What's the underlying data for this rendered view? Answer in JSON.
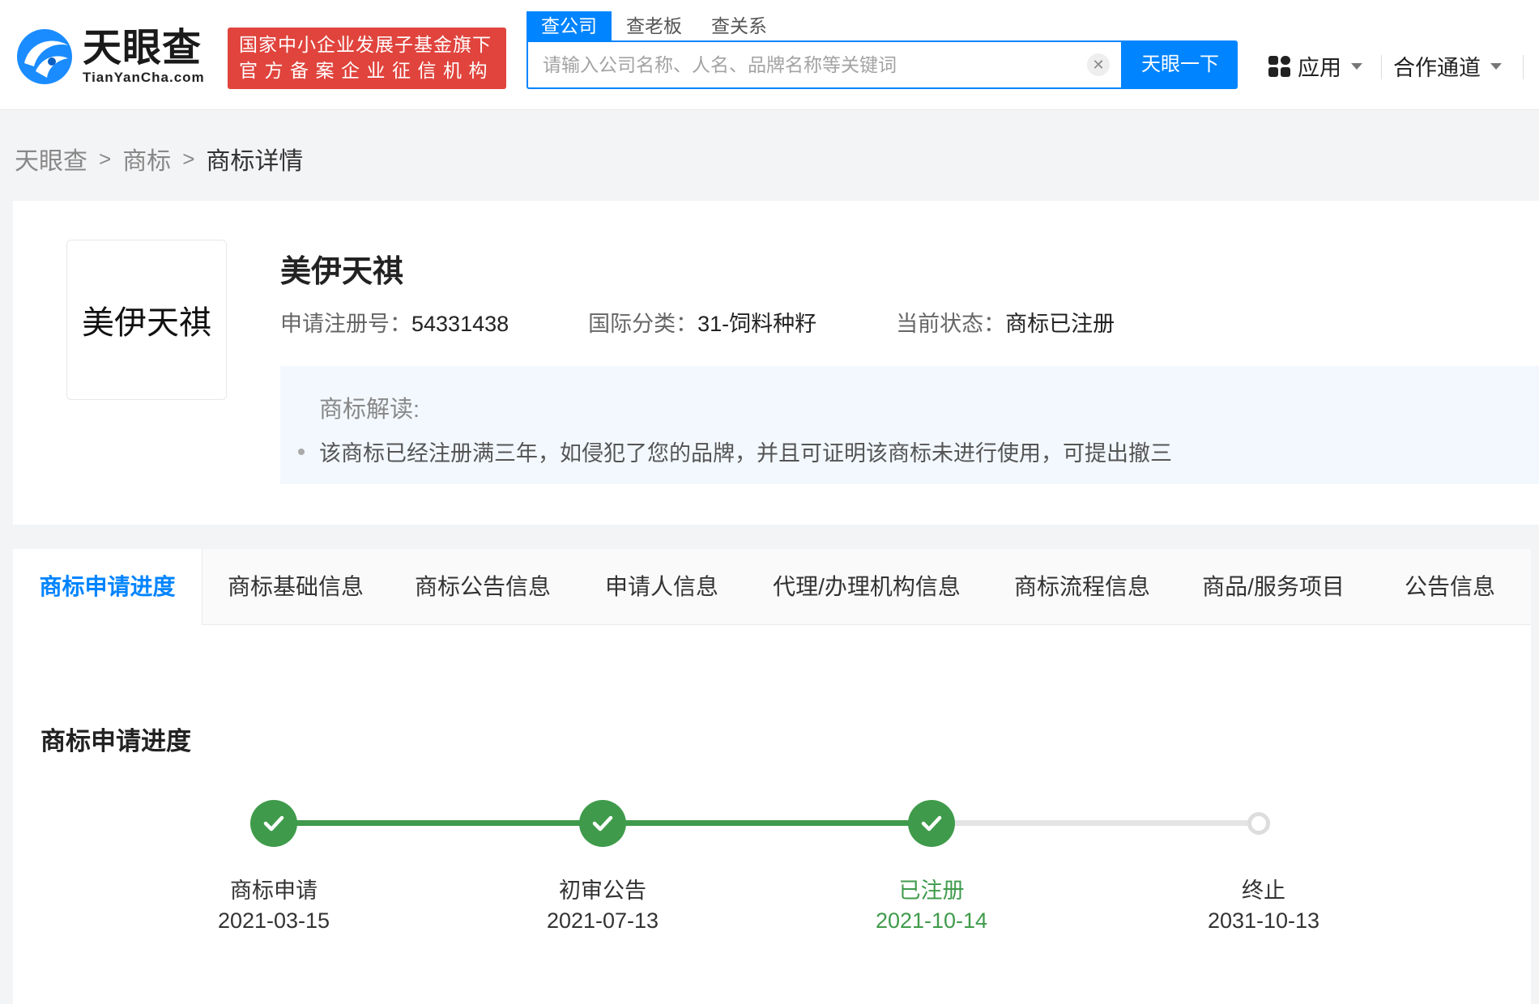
{
  "header": {
    "logo_cn": "天眼查",
    "logo_en": "TianYanCha.com",
    "badge_line1": "国家中小企业发展子基金旗下",
    "badge_line2": "官方备案企业征信机构",
    "search_tabs": [
      "查公司",
      "查老板",
      "查关系"
    ],
    "search_placeholder": "请输入公司名称、人名、品牌名称等关键词",
    "search_button": "天眼一下",
    "nav_apps": "应用",
    "nav_coop": "合作通道"
  },
  "breadcrumb": [
    "天眼查",
    "商标",
    "商标详情"
  ],
  "trademark": {
    "image_text": "美伊天祺",
    "name": "美伊天祺",
    "reg_no_label": "申请注册号：",
    "reg_no": "54331438",
    "class_label": "国际分类：",
    "class_value": "31-饲料种籽",
    "status_label": "当前状态：",
    "status_value": "商标已注册",
    "interpret_title": "商标解读:",
    "interpret_text": "该商标已经注册满三年，如侵犯了您的品牌，并且可证明该商标未进行使用，可提出撤三"
  },
  "tabs": [
    "商标申请进度",
    "商标基础信息",
    "商标公告信息",
    "申请人信息",
    "代理/办理机构信息",
    "商标流程信息",
    "商品/服务项目",
    "公告信息"
  ],
  "progress": {
    "title": "商标申请进度",
    "steps": [
      {
        "label": "商标申请",
        "date": "2021-03-15",
        "status": "done"
      },
      {
        "label": "初审公告",
        "date": "2021-07-13",
        "status": "done"
      },
      {
        "label": "已注册",
        "date": "2021-10-14",
        "status": "current"
      },
      {
        "label": "终止",
        "date": "2031-10-13",
        "status": "pending"
      }
    ]
  },
  "colors": {
    "brand_blue": "#0084ff",
    "badge_red": "#e0443d",
    "success_green": "#3f9b4b"
  }
}
